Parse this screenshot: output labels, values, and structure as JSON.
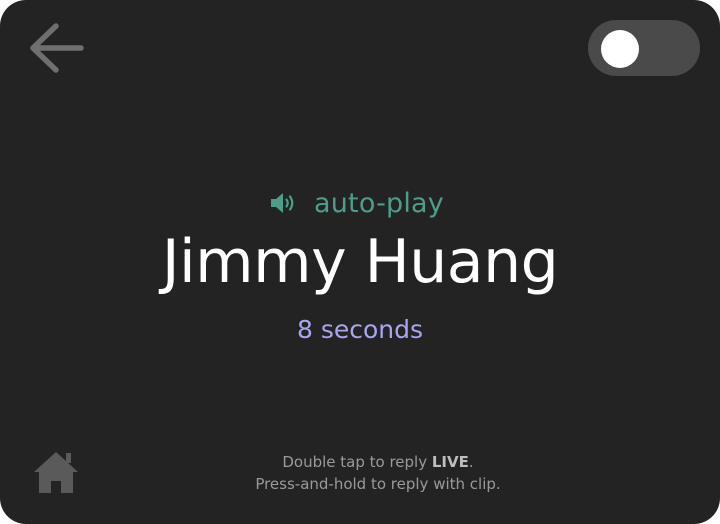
{
  "header": {
    "back_icon": "arrow-left-icon",
    "toggle_state": "off"
  },
  "call": {
    "speaker_icon": "speaker-icon",
    "autoplay_label": "auto-play",
    "caller_name": "Jimmy Huang",
    "duration_label": "8 seconds"
  },
  "footer": {
    "home_icon": "home-icon",
    "hint_line1_prefix": "Double tap to reply ",
    "hint_line1_bold": "LIVE",
    "hint_line1_suffix": ".",
    "hint_line2": "Press-and-hold to reply with clip."
  },
  "colors": {
    "background": "#232323",
    "accent_teal": "#4d9d8a",
    "duration_lavender": "#a8a6ef",
    "toggle_track": "#4a4a4a",
    "icon_gray": "#6f6f6f"
  }
}
